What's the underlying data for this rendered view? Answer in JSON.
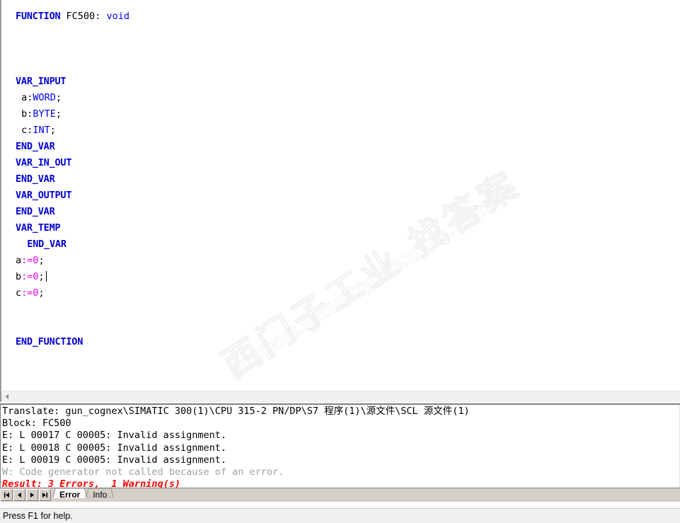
{
  "editor": {
    "lines": [
      {
        "indent": 0,
        "tokens": [
          {
            "t": "kw",
            "v": "FUNCTION"
          },
          {
            "t": "pn",
            "v": " FC500: "
          },
          {
            "t": "typ",
            "v": "void"
          }
        ]
      },
      {
        "indent": 0,
        "tokens": []
      },
      {
        "indent": 0,
        "tokens": []
      },
      {
        "indent": 0,
        "tokens": []
      },
      {
        "indent": 0,
        "tokens": [
          {
            "t": "kw",
            "v": "VAR_INPUT"
          }
        ]
      },
      {
        "indent": 0,
        "tokens": [
          {
            "t": "pn",
            "v": " a:"
          },
          {
            "t": "typ",
            "v": "WORD"
          },
          {
            "t": "pn",
            "v": ";"
          }
        ]
      },
      {
        "indent": 0,
        "tokens": [
          {
            "t": "pn",
            "v": " b:"
          },
          {
            "t": "typ",
            "v": "BYTE"
          },
          {
            "t": "pn",
            "v": ";"
          }
        ]
      },
      {
        "indent": 0,
        "tokens": [
          {
            "t": "pn",
            "v": " c:"
          },
          {
            "t": "typ",
            "v": "INT"
          },
          {
            "t": "pn",
            "v": ";"
          }
        ]
      },
      {
        "indent": 0,
        "tokens": [
          {
            "t": "kw",
            "v": "END_VAR"
          }
        ]
      },
      {
        "indent": 0,
        "tokens": [
          {
            "t": "kw",
            "v": "VAR_IN_OUT"
          }
        ]
      },
      {
        "indent": 0,
        "tokens": [
          {
            "t": "kw",
            "v": "END_VAR"
          }
        ]
      },
      {
        "indent": 0,
        "tokens": [
          {
            "t": "kw",
            "v": "VAR_OUTPUT"
          }
        ]
      },
      {
        "indent": 0,
        "tokens": [
          {
            "t": "kw",
            "v": "END_VAR"
          }
        ]
      },
      {
        "indent": 0,
        "tokens": [
          {
            "t": "kw",
            "v": "VAR_TEMP"
          }
        ]
      },
      {
        "indent": 0,
        "tokens": [
          {
            "t": "pn",
            "v": "  "
          },
          {
            "t": "kw",
            "v": "END_VAR"
          }
        ]
      },
      {
        "indent": 0,
        "tokens": [
          {
            "t": "pn",
            "v": "a"
          },
          {
            "t": "op",
            "v": ":="
          },
          {
            "t": "num",
            "v": "0"
          },
          {
            "t": "pn",
            "v": ";"
          }
        ]
      },
      {
        "indent": 0,
        "tokens": [
          {
            "t": "pn",
            "v": "b"
          },
          {
            "t": "op",
            "v": ":="
          },
          {
            "t": "num",
            "v": "0"
          },
          {
            "t": "pn",
            "v": ";"
          }
        ],
        "caret": true
      },
      {
        "indent": 0,
        "tokens": [
          {
            "t": "pn",
            "v": "c"
          },
          {
            "t": "op",
            "v": ":="
          },
          {
            "t": "num",
            "v": "0"
          },
          {
            "t": "pn",
            "v": ";"
          }
        ]
      },
      {
        "indent": 0,
        "tokens": []
      },
      {
        "indent": 0,
        "tokens": []
      },
      {
        "indent": 0,
        "tokens": [
          {
            "t": "kw",
            "v": "END_FUNCTION"
          }
        ]
      }
    ],
    "watermark": {
      "chinese": "西门子工业  找答案",
      "url": "support.industry.siemens.com/cs"
    },
    "colors": {
      "keyword": "#0000d0",
      "type": "#0000ee",
      "operator": "#ee00ee",
      "plain": "#000000"
    }
  },
  "scrollbar": {
    "left_arrow_icon": "triangle-left-icon",
    "position": "left"
  },
  "output": {
    "lines": [
      {
        "style": "err",
        "text": "Translate: gun_cognex\\SIMATIC 300(1)\\CPU 315-2 PN/DP\\S7 程序(1)\\源文件\\SCL 源文件(1)"
      },
      {
        "style": "err",
        "text": "Block: FC500"
      },
      {
        "style": "err",
        "text": "E: L 00017 C 00005: Invalid assignment."
      },
      {
        "style": "err",
        "text": "E: L 00018 C 00005: Invalid assignment."
      },
      {
        "style": "err",
        "text": "E: L 00019 C 00005: Invalid assignment."
      },
      {
        "style": "warn",
        "text": "W: Code generator not called because of an error."
      },
      {
        "style": "result",
        "text": "Result: 3 Errors,  1 Warning(s)"
      }
    ],
    "colors": {
      "error": "#000000",
      "warning": "#a0a0a0",
      "result": "#ff0000"
    }
  },
  "tabstrip": {
    "nav_buttons": [
      {
        "name": "first-record-button",
        "icon": "skip-first-icon"
      },
      {
        "name": "previous-record-button",
        "icon": "triangle-left-icon"
      },
      {
        "name": "next-record-button",
        "icon": "triangle-right-icon"
      },
      {
        "name": "last-record-button",
        "icon": "skip-last-icon"
      }
    ],
    "tabs": [
      {
        "label": "Error",
        "active": true
      },
      {
        "label": "Info",
        "active": false
      }
    ]
  },
  "statusbar": {
    "text": "Press F1 for help."
  }
}
